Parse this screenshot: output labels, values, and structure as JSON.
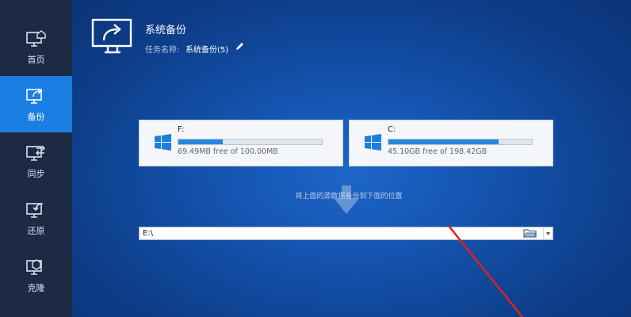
{
  "sidebar": {
    "items": [
      {
        "label": "首页",
        "icon": "home-monitor-icon"
      },
      {
        "label": "备份",
        "icon": "backup-monitor-icon",
        "active": true
      },
      {
        "label": "同步",
        "icon": "sync-monitor-icon"
      },
      {
        "label": "还原",
        "icon": "restore-monitor-icon"
      },
      {
        "label": "克隆",
        "icon": "clone-monitor-icon"
      }
    ]
  },
  "header": {
    "title": "系统备份",
    "task_label": "任务名称:",
    "task_value": "系统备份(5)",
    "icon": "backup-share-icon"
  },
  "disks": [
    {
      "name": "F:",
      "free_text": "69.49MB free of 100.00MB",
      "used_fraction": 0.31
    },
    {
      "name": "C:",
      "free_text": "45.10GB free of 198.42GB",
      "used_fraction": 0.77
    }
  ],
  "hint": "将上面的源数据备份到下面的位置",
  "destination": {
    "value": "E:\\"
  },
  "colors": {
    "sidebar": "#1c2a44",
    "active": "#1b7ee3",
    "background": "#1556b3",
    "bar_fill": "#2a86de",
    "annotation": "#e0201c"
  }
}
